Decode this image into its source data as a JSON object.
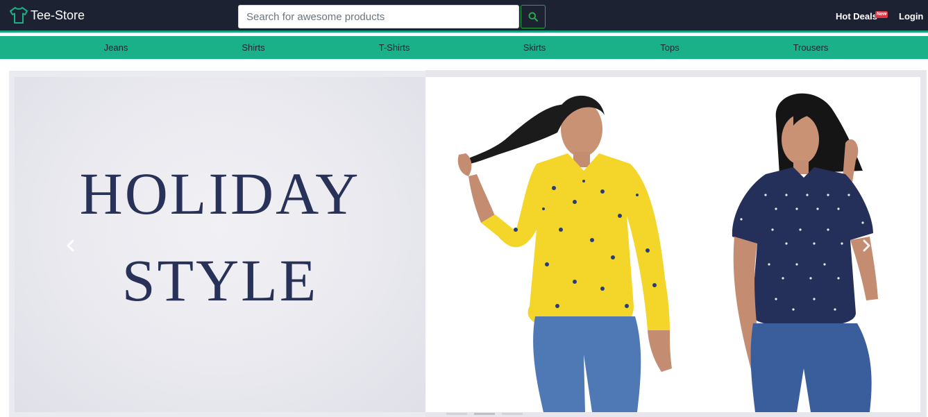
{
  "header": {
    "brand": {
      "name": "Tee-Store",
      "icon": "tshirt-icon"
    },
    "search": {
      "placeholder": "Search for awesome products",
      "value": "",
      "button_icon": "search-icon"
    },
    "hot_deals": {
      "label": "Hot Deals",
      "badge": "New"
    },
    "login_label": "Login"
  },
  "categories": [
    {
      "label": "Jeans"
    },
    {
      "label": "Shirts"
    },
    {
      "label": "T-Shirts"
    },
    {
      "label": "Skirts"
    },
    {
      "label": "Tops"
    },
    {
      "label": "Trousers"
    }
  ],
  "carousel": {
    "slide": {
      "headline_line1": "HOLIDAY",
      "headline_line2": "STYLE",
      "models": [
        {
          "top": "yellow floral shirt",
          "bottoms": "blue jeans"
        },
        {
          "top": "navy polka-dot top",
          "bottoms": "blue jeans"
        }
      ]
    },
    "prev_icon": "chevron-left-icon",
    "next_icon": "chevron-right-icon",
    "indicator_count": 3,
    "active_indicator": 1
  },
  "colors": {
    "navbar_bg": "#1d2232",
    "accent_green": "#1ab188",
    "search_button_border": "#28a745",
    "badge_red": "#dc3545",
    "headline_navy": "#283157"
  }
}
